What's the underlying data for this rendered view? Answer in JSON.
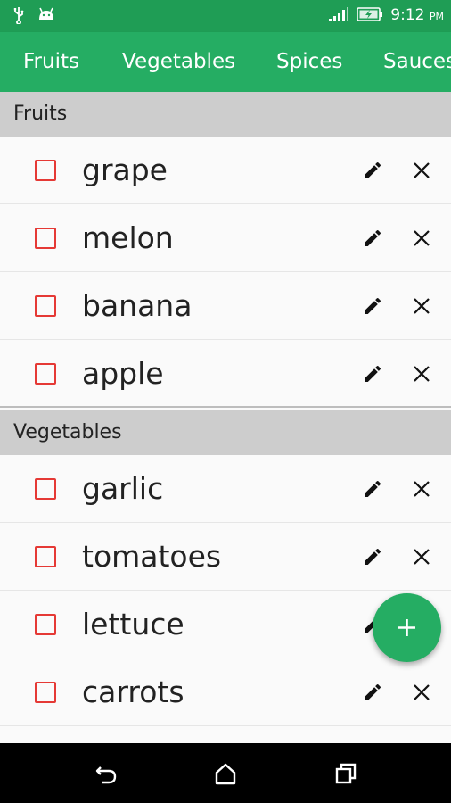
{
  "status_bar": {
    "time": "9:12",
    "ampm": "PM",
    "icons": [
      "usb-icon",
      "android-icon",
      "signal-icon",
      "battery-charging-icon"
    ]
  },
  "tabs": [
    {
      "label": "Fruits"
    },
    {
      "label": "Vegetables"
    },
    {
      "label": "Spices"
    },
    {
      "label": "Sauces"
    }
  ],
  "sections": [
    {
      "title": "Fruits",
      "items": [
        {
          "label": "grape",
          "checked": false
        },
        {
          "label": "melon",
          "checked": false
        },
        {
          "label": "banana",
          "checked": false
        },
        {
          "label": "apple",
          "checked": false
        }
      ]
    },
    {
      "title": "Vegetables",
      "items": [
        {
          "label": "garlic",
          "checked": false
        },
        {
          "label": "tomatoes",
          "checked": false
        },
        {
          "label": "lettuce",
          "checked": false
        },
        {
          "label": "carrots",
          "checked": false
        }
      ]
    }
  ],
  "fab": {
    "icon": "plus-icon"
  },
  "nav": {
    "icons": [
      "back-icon",
      "home-icon",
      "recents-icon"
    ]
  },
  "colors": {
    "primary": "#25ad63",
    "status_bar": "#1f9d55",
    "checkbox": "#e53935",
    "section_bg": "#cdcdcd"
  }
}
